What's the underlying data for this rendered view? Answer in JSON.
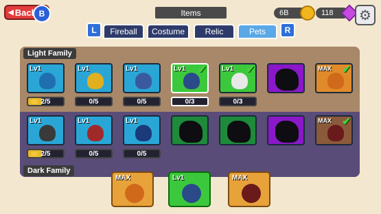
{
  "header": {
    "back_label": "Back",
    "back_badge": "B",
    "title": "Items",
    "gold": "6B",
    "gems": "118"
  },
  "tabs": {
    "left_shoulder": "L",
    "right_shoulder": "R",
    "items": [
      "Fireball",
      "Costume",
      "Relic",
      "Pets"
    ],
    "active": "Pets"
  },
  "families": {
    "light": "Light Family",
    "dark": "Dark Family"
  },
  "light_row": [
    {
      "level": "Lv1",
      "progress": "2/5",
      "fill": 0.4,
      "color": "cyan",
      "creature_color": "#1f6fb0"
    },
    {
      "level": "Lv1",
      "progress": "0/5",
      "fill": 0,
      "color": "cyan",
      "creature_color": "#e0b020"
    },
    {
      "level": "Lv1",
      "progress": "0/5",
      "fill": 0,
      "color": "cyan",
      "creature_color": "#3a5aa0"
    },
    {
      "level": "Lv1",
      "progress": "0/3",
      "fill": 0,
      "color": "green",
      "creature_color": "#2a4a8a",
      "checked": true,
      "selected": true
    },
    {
      "level": "Lv1",
      "progress": "0/3",
      "fill": 0,
      "color": "green",
      "creature_color": "#e8e8e8",
      "checked": true
    },
    {
      "color": "purple",
      "locked": true
    },
    {
      "level": "MAX",
      "color": "orange",
      "creature_color": "#d06a1a",
      "checked": true
    }
  ],
  "dark_row": [
    {
      "level": "Lv1",
      "progress": "2/5",
      "fill": 0.4,
      "color": "cyan",
      "creature_color": "#3a3a3a"
    },
    {
      "level": "Lv1",
      "progress": "0/5",
      "fill": 0,
      "color": "cyan",
      "creature_color": "#a02a2a"
    },
    {
      "level": "Lv1",
      "progress": "0/5",
      "fill": 0,
      "color": "cyan",
      "creature_color": "#1a3a7a"
    },
    {
      "color": "darkgreen",
      "locked": true
    },
    {
      "color": "darkgreen",
      "locked": true
    },
    {
      "color": "purple",
      "locked": true
    },
    {
      "level": "MAX",
      "color": "brown",
      "creature_color": "#6a1a1a",
      "checked": true
    }
  ],
  "bottom": [
    {
      "level": "MAX",
      "color": "#e8a23a",
      "creature_color": "#d06a1a"
    },
    {
      "level": "Lv1",
      "color": "#3cc83c",
      "creature_color": "#2a4a8a"
    },
    {
      "level": "MAX",
      "color": "#e8a23a",
      "creature_color": "#6a1a1a"
    }
  ]
}
